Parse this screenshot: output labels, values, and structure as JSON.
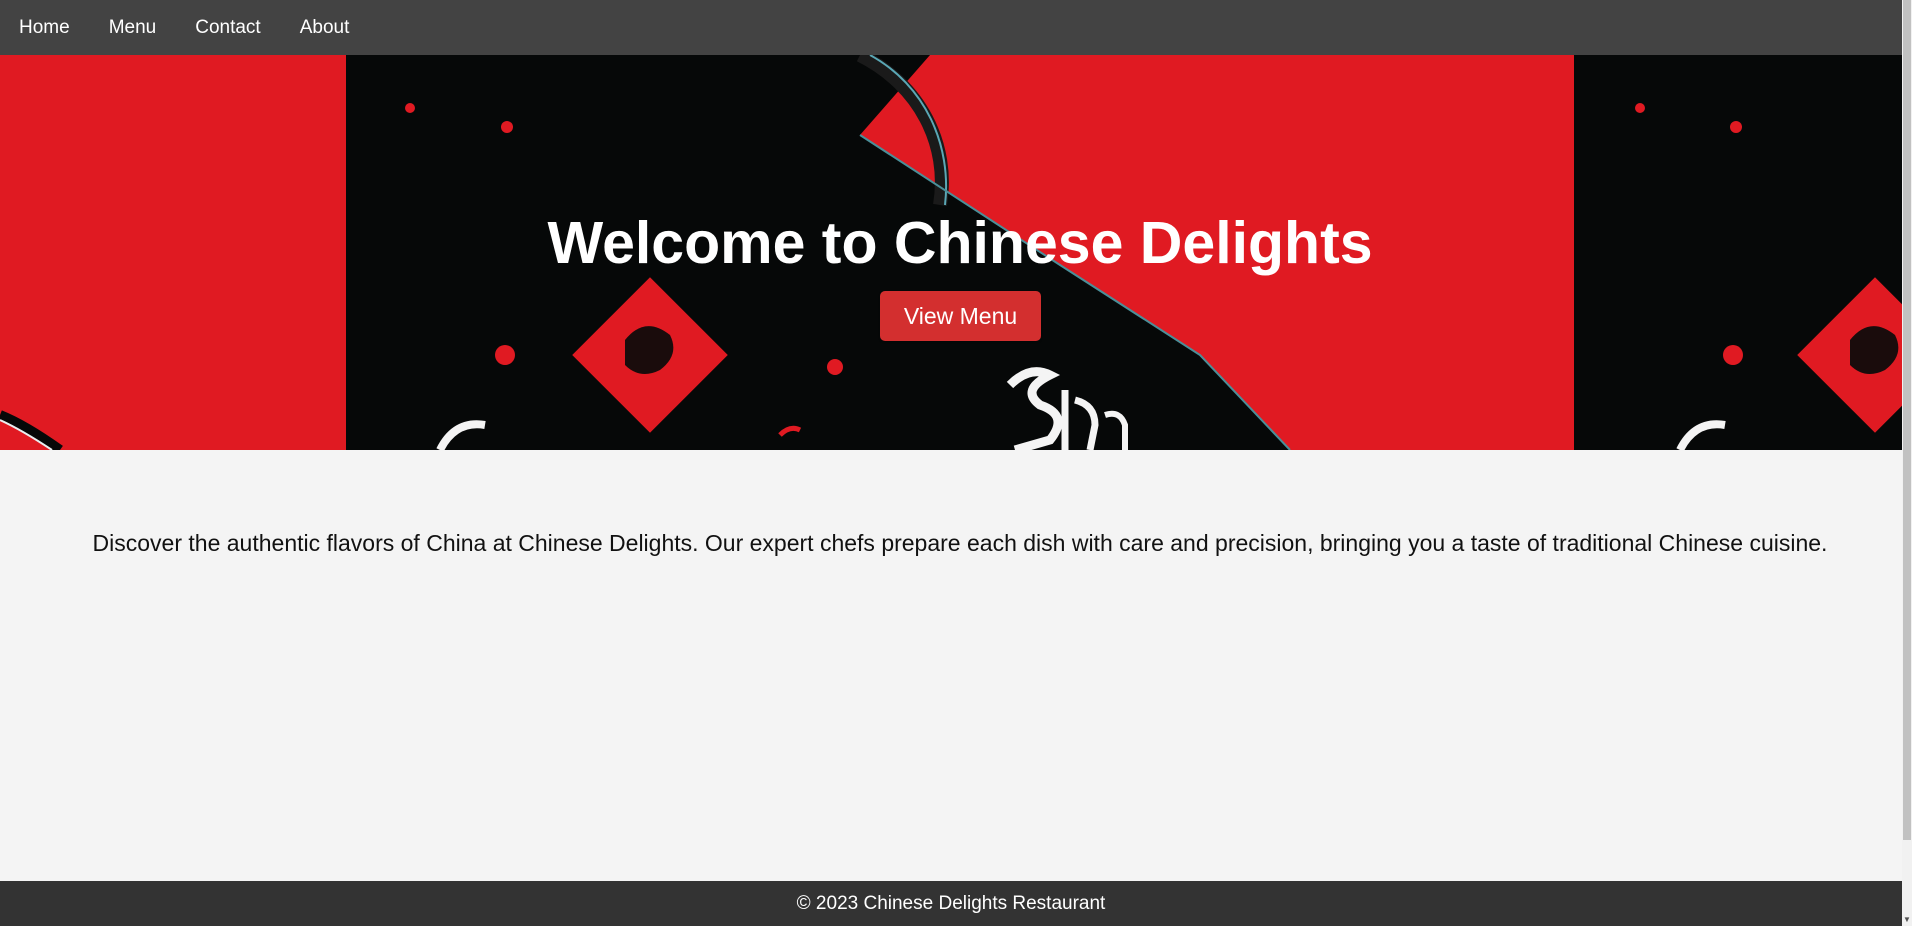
{
  "nav": {
    "items": [
      {
        "label": "Home"
      },
      {
        "label": "Menu"
      },
      {
        "label": "Contact"
      },
      {
        "label": "About"
      }
    ]
  },
  "hero": {
    "title": "Welcome to Chinese Delights",
    "button_label": "View Menu"
  },
  "main": {
    "intro": "Discover the authentic flavors of China at Chinese Delights. Our expert chefs prepare each dish with care and precision, bringing you a taste of traditional Chinese cuisine."
  },
  "footer": {
    "text": "© 2023 Chinese Delights Restaurant"
  },
  "colors": {
    "nav_bg": "#434343",
    "hero_red": "#e01a22",
    "hero_black": "#060808",
    "button_red": "#d32f2f",
    "page_bg": "#f4f4f4",
    "footer_bg": "#333333"
  }
}
